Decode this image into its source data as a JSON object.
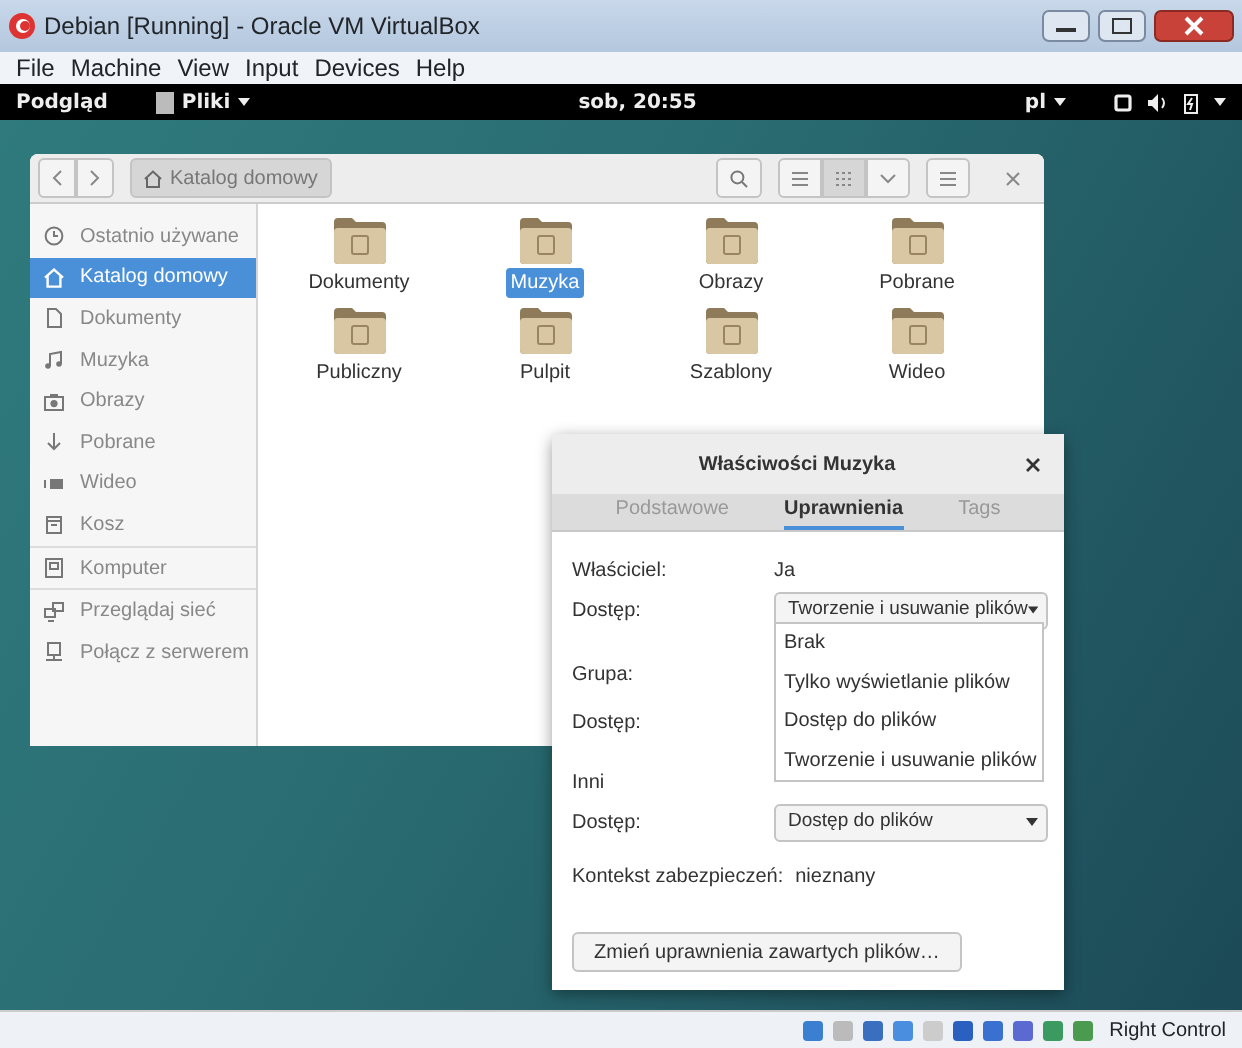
{
  "window": {
    "title": "Debian [Running] - Oracle VM VirtualBox"
  },
  "menu": [
    "File",
    "Machine",
    "View",
    "Input",
    "Devices",
    "Help"
  ],
  "top_bar": {
    "activities": "Podgląd",
    "app_menu": "Pliki",
    "clock": "sob, 20:55",
    "language": "pl"
  },
  "files": {
    "path": "Katalog domowy",
    "grid_view_selected": true,
    "sidebar": [
      {
        "label": "Ostatnio używane",
        "selected": false
      },
      {
        "label": "Katalog domowy",
        "selected": true
      },
      {
        "label": "Dokumenty",
        "selected": false
      },
      {
        "label": "Muzyka",
        "selected": false
      },
      {
        "label": "Obrazy",
        "selected": false
      },
      {
        "label": "Pobrane",
        "selected": false
      },
      {
        "label": "Wideo",
        "selected": false
      },
      {
        "label": "Kosz",
        "selected": false
      },
      {
        "label": "Komputer",
        "selected": false
      },
      {
        "label": "Przeglądaj sieć",
        "selected": false
      },
      {
        "label": "Połącz z serwerem",
        "selected": false
      }
    ],
    "folders": [
      {
        "label": "Dokumenty",
        "selected": false
      },
      {
        "label": "Muzyka",
        "selected": true
      },
      {
        "label": "Obrazy",
        "selected": false
      },
      {
        "label": "Pobrane",
        "selected": false
      },
      {
        "label": "Publiczny",
        "selected": false
      },
      {
        "label": "Pulpit",
        "selected": false
      },
      {
        "label": "Szablony",
        "selected": false
      },
      {
        "label": "Wideo",
        "selected": false
      }
    ]
  },
  "dialog": {
    "title": "Właściwości Muzyka",
    "tabs": [
      {
        "label": "Podstawowe",
        "selected": false
      },
      {
        "label": "Uprawnienia",
        "selected": true
      },
      {
        "label": "Tags",
        "selected": false
      }
    ],
    "owner_label": "Właściciel:",
    "owner_value": "Ja",
    "owner_access_label": "Dostęp:",
    "owner_access_value": "Tworzenie i usuwanie plików",
    "group_label": "Grupa:",
    "group_access_label": "Dostęp:",
    "others_label": "Inni",
    "others_access_label": "Dostęp:",
    "others_access_value": "Dostęp do plików",
    "context_label": "Kontekst zabezpieczeń:",
    "context_value": "nieznany",
    "button": "Zmień uprawnienia zawartych plików…",
    "dropdown_options": [
      "Brak",
      "Tylko wyświetlanie plików",
      "Dostęp do plików",
      "Tworzenie i usuwanie plików"
    ]
  },
  "status_bar": {
    "host_key": "Right Control"
  }
}
